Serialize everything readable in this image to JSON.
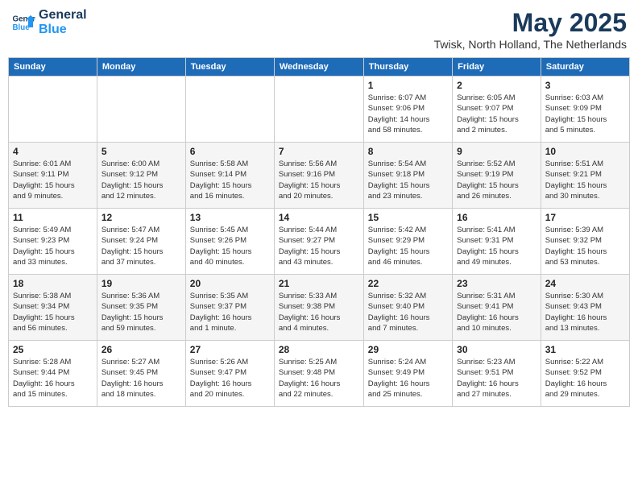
{
  "logo": {
    "line1": "General",
    "line2": "Blue"
  },
  "title": "May 2025",
  "location": "Twisk, North Holland, The Netherlands",
  "headers": [
    "Sunday",
    "Monday",
    "Tuesday",
    "Wednesday",
    "Thursday",
    "Friday",
    "Saturday"
  ],
  "weeks": [
    [
      {
        "day": "",
        "info": ""
      },
      {
        "day": "",
        "info": ""
      },
      {
        "day": "",
        "info": ""
      },
      {
        "day": "",
        "info": ""
      },
      {
        "day": "1",
        "info": "Sunrise: 6:07 AM\nSunset: 9:06 PM\nDaylight: 14 hours\nand 58 minutes."
      },
      {
        "day": "2",
        "info": "Sunrise: 6:05 AM\nSunset: 9:07 PM\nDaylight: 15 hours\nand 2 minutes."
      },
      {
        "day": "3",
        "info": "Sunrise: 6:03 AM\nSunset: 9:09 PM\nDaylight: 15 hours\nand 5 minutes."
      }
    ],
    [
      {
        "day": "4",
        "info": "Sunrise: 6:01 AM\nSunset: 9:11 PM\nDaylight: 15 hours\nand 9 minutes."
      },
      {
        "day": "5",
        "info": "Sunrise: 6:00 AM\nSunset: 9:12 PM\nDaylight: 15 hours\nand 12 minutes."
      },
      {
        "day": "6",
        "info": "Sunrise: 5:58 AM\nSunset: 9:14 PM\nDaylight: 15 hours\nand 16 minutes."
      },
      {
        "day": "7",
        "info": "Sunrise: 5:56 AM\nSunset: 9:16 PM\nDaylight: 15 hours\nand 20 minutes."
      },
      {
        "day": "8",
        "info": "Sunrise: 5:54 AM\nSunset: 9:18 PM\nDaylight: 15 hours\nand 23 minutes."
      },
      {
        "day": "9",
        "info": "Sunrise: 5:52 AM\nSunset: 9:19 PM\nDaylight: 15 hours\nand 26 minutes."
      },
      {
        "day": "10",
        "info": "Sunrise: 5:51 AM\nSunset: 9:21 PM\nDaylight: 15 hours\nand 30 minutes."
      }
    ],
    [
      {
        "day": "11",
        "info": "Sunrise: 5:49 AM\nSunset: 9:23 PM\nDaylight: 15 hours\nand 33 minutes."
      },
      {
        "day": "12",
        "info": "Sunrise: 5:47 AM\nSunset: 9:24 PM\nDaylight: 15 hours\nand 37 minutes."
      },
      {
        "day": "13",
        "info": "Sunrise: 5:45 AM\nSunset: 9:26 PM\nDaylight: 15 hours\nand 40 minutes."
      },
      {
        "day": "14",
        "info": "Sunrise: 5:44 AM\nSunset: 9:27 PM\nDaylight: 15 hours\nand 43 minutes."
      },
      {
        "day": "15",
        "info": "Sunrise: 5:42 AM\nSunset: 9:29 PM\nDaylight: 15 hours\nand 46 minutes."
      },
      {
        "day": "16",
        "info": "Sunrise: 5:41 AM\nSunset: 9:31 PM\nDaylight: 15 hours\nand 49 minutes."
      },
      {
        "day": "17",
        "info": "Sunrise: 5:39 AM\nSunset: 9:32 PM\nDaylight: 15 hours\nand 53 minutes."
      }
    ],
    [
      {
        "day": "18",
        "info": "Sunrise: 5:38 AM\nSunset: 9:34 PM\nDaylight: 15 hours\nand 56 minutes."
      },
      {
        "day": "19",
        "info": "Sunrise: 5:36 AM\nSunset: 9:35 PM\nDaylight: 15 hours\nand 59 minutes."
      },
      {
        "day": "20",
        "info": "Sunrise: 5:35 AM\nSunset: 9:37 PM\nDaylight: 16 hours\nand 1 minute."
      },
      {
        "day": "21",
        "info": "Sunrise: 5:33 AM\nSunset: 9:38 PM\nDaylight: 16 hours\nand 4 minutes."
      },
      {
        "day": "22",
        "info": "Sunrise: 5:32 AM\nSunset: 9:40 PM\nDaylight: 16 hours\nand 7 minutes."
      },
      {
        "day": "23",
        "info": "Sunrise: 5:31 AM\nSunset: 9:41 PM\nDaylight: 16 hours\nand 10 minutes."
      },
      {
        "day": "24",
        "info": "Sunrise: 5:30 AM\nSunset: 9:43 PM\nDaylight: 16 hours\nand 13 minutes."
      }
    ],
    [
      {
        "day": "25",
        "info": "Sunrise: 5:28 AM\nSunset: 9:44 PM\nDaylight: 16 hours\nand 15 minutes."
      },
      {
        "day": "26",
        "info": "Sunrise: 5:27 AM\nSunset: 9:45 PM\nDaylight: 16 hours\nand 18 minutes."
      },
      {
        "day": "27",
        "info": "Sunrise: 5:26 AM\nSunset: 9:47 PM\nDaylight: 16 hours\nand 20 minutes."
      },
      {
        "day": "28",
        "info": "Sunrise: 5:25 AM\nSunset: 9:48 PM\nDaylight: 16 hours\nand 22 minutes."
      },
      {
        "day": "29",
        "info": "Sunrise: 5:24 AM\nSunset: 9:49 PM\nDaylight: 16 hours\nand 25 minutes."
      },
      {
        "day": "30",
        "info": "Sunrise: 5:23 AM\nSunset: 9:51 PM\nDaylight: 16 hours\nand 27 minutes."
      },
      {
        "day": "31",
        "info": "Sunrise: 5:22 AM\nSunset: 9:52 PM\nDaylight: 16 hours\nand 29 minutes."
      }
    ]
  ]
}
